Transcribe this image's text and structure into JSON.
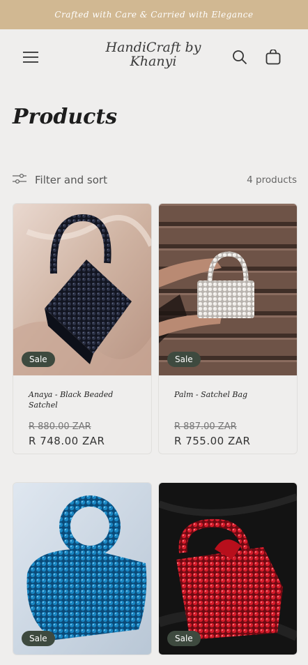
{
  "announcement": "Crafted with Care & Carried with Elegance",
  "header": {
    "logo": "HandiCraft by Khanyi",
    "icons": [
      "hamburger-menu-icon",
      "search-icon",
      "cart-icon"
    ]
  },
  "page": {
    "title": "Products",
    "filter_label": "Filter and sort",
    "product_count": "4 products"
  },
  "colors": {
    "announcement_bg": "#d1b892",
    "badge_bg": "#3e4a3f",
    "page_bg": "#efeeed"
  },
  "products": [
    {
      "name": "Anaya - Black Beaded Satchel",
      "old_price": "R 880.00 ZAR",
      "price": "R 748.00 ZAR",
      "badge": "Sale"
    },
    {
      "name": "Palm - Satchel Bag",
      "old_price": "R 887.00 ZAR",
      "price": "R 755.00 ZAR",
      "badge": "Sale"
    },
    {
      "badge": "Sale"
    },
    {
      "badge": "Sale"
    }
  ]
}
